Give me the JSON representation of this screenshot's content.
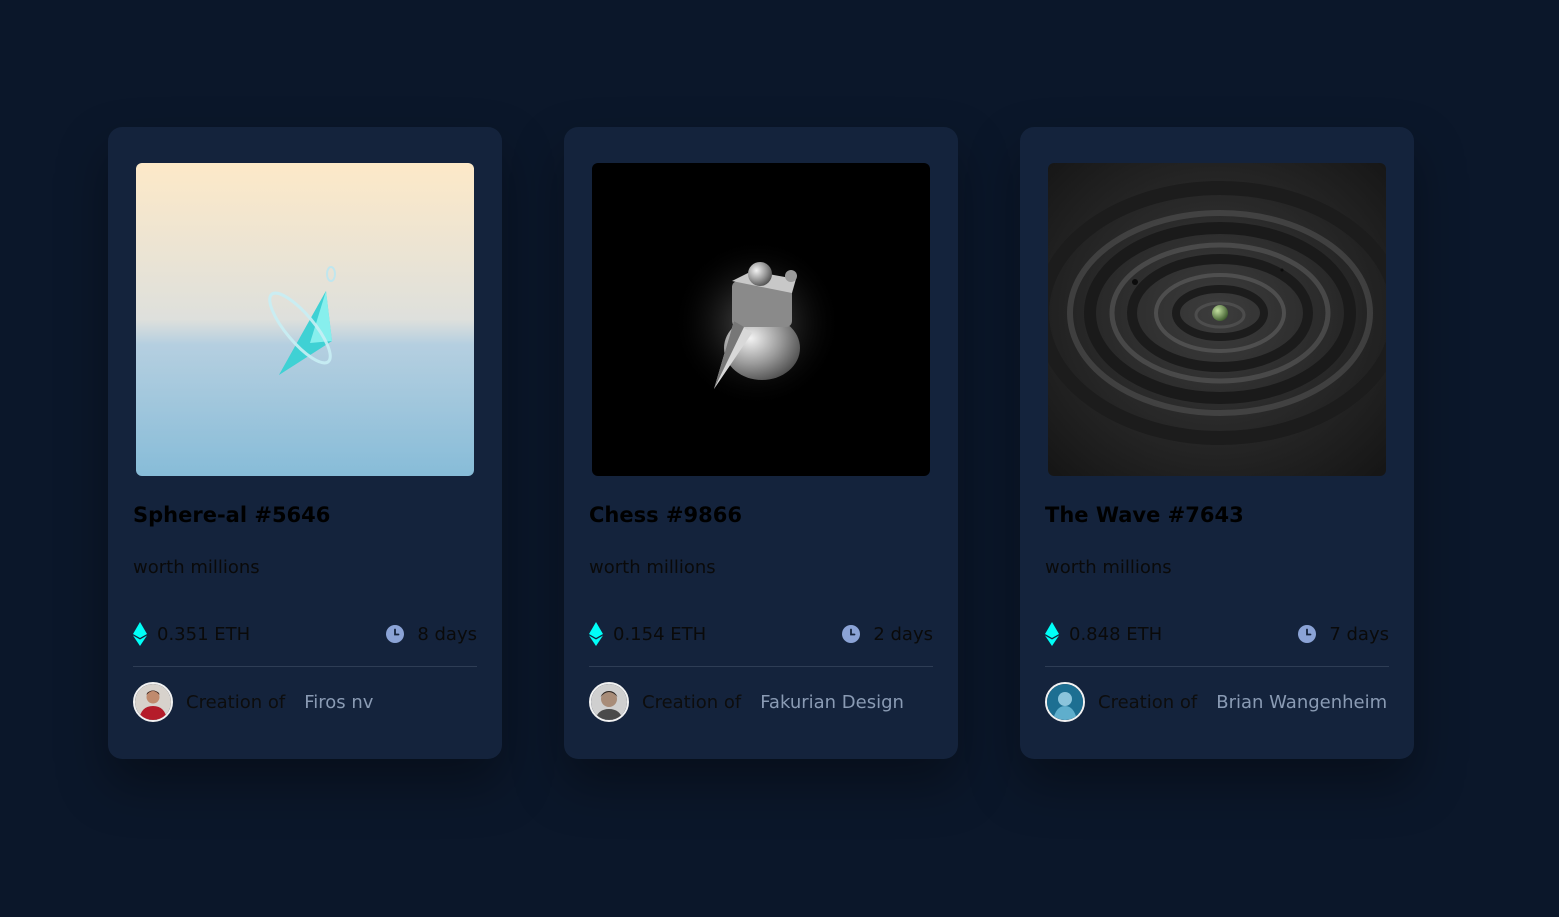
{
  "cards": [
    {
      "title": "Sphere-al #5646",
      "description": "worth millions",
      "price": "0.351 ETH",
      "time_left": "8 days",
      "creator_prefix": "Creation of",
      "creator_name": "Firos nv",
      "image": "crystal-with-ring-on-pastel-sky",
      "avatar": "man-in-red-shirt"
    },
    {
      "title": "Chess #9866",
      "description": "worth millions",
      "price": "0.154 ETH",
      "time_left": "2 days",
      "creator_prefix": "Creation of",
      "creator_name": "Fakurian Design",
      "image": "chess-piece-on-black",
      "avatar": "man-portrait-grey"
    },
    {
      "title": "The Wave #7643",
      "description": "worth millions",
      "price": "0.848 ETH",
      "time_left": "7 days",
      "creator_prefix": "Creation of",
      "creator_name": "Brian Wangenheim",
      "image": "dark-ripple-waves",
      "avatar": "blue-portrait"
    }
  ],
  "icons": {
    "price": "ethereum-icon",
    "time": "clock-icon"
  },
  "colors": {
    "background": "#0b172a",
    "card": "#14233c",
    "ethereum": "#00fff8",
    "clock": "#8ba3d6",
    "creator_name": "#8a9bb4"
  }
}
